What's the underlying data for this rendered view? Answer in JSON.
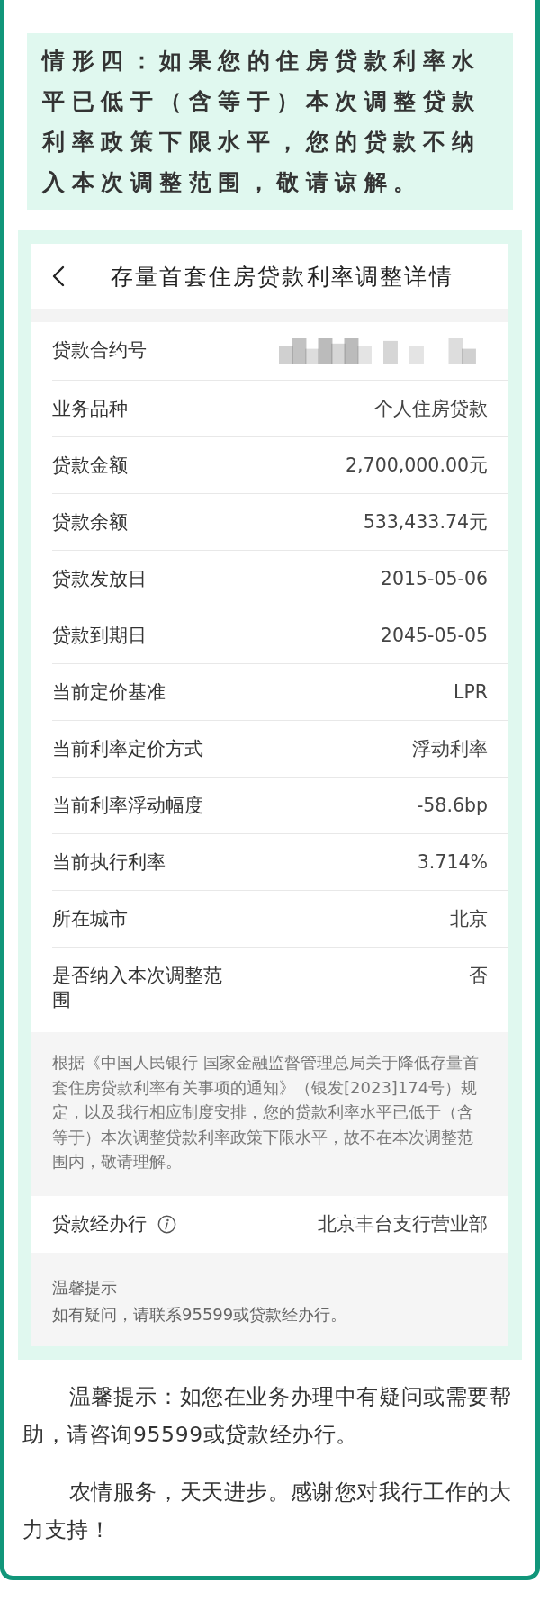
{
  "callout": {
    "text": "情形四：如果您的住房贷款利率水平已低于（含等于）本次调整贷款利率政策下限水平，您的贷款不纳入本次调整范围，敬请谅解。"
  },
  "detail_page": {
    "title": "存量首套住房贷款利率调整详情",
    "rows": [
      {
        "label": "贷款合约号",
        "kind": "blurred"
      },
      {
        "label": "业务品种",
        "kind": "text",
        "value": "个人住房贷款"
      },
      {
        "label": "贷款金额",
        "kind": "text",
        "value": "2,700,000.00元"
      },
      {
        "label": "贷款余额",
        "kind": "text",
        "value": "533,433.74元"
      },
      {
        "label": "贷款发放日",
        "kind": "text",
        "value": "2015-05-06"
      },
      {
        "label": "贷款到期日",
        "kind": "text",
        "value": "2045-05-05"
      },
      {
        "label": "当前定价基准",
        "kind": "text",
        "value": "LPR"
      },
      {
        "label": "当前利率定价方式",
        "kind": "text",
        "value": "浮动利率"
      },
      {
        "label": "当前利率浮动幅度",
        "kind": "text",
        "value": "-58.6bp"
      },
      {
        "label": "当前执行利率",
        "kind": "text",
        "value": "3.714%"
      },
      {
        "label": "所在城市",
        "kind": "text",
        "value": "北京"
      },
      {
        "label": "是否纳入本次调整范围",
        "kind": "text",
        "value": "否"
      }
    ],
    "note": "根据《中国人民银行 国家金融监督管理总局关于降低存量首套住房贷款利率有关事项的通知》（银发[2023]174号）规定，以及我行相应制度安排，您的贷款利率水平已低于（含等于）本次调整贷款利率政策下限水平，故不在本次调整范围内，敬请理解。",
    "branch": {
      "label": "贷款经办行",
      "value": "北京丰台支行营业部"
    },
    "tip": {
      "title": "温馨提示",
      "text": "如有疑问，请联系95599或贷款经办行。"
    }
  },
  "paragraphs": [
    "温馨提示：如您在业务办理中有疑问或需要帮助，请咨询95599或贷款经办行。",
    "农情服务，天天进步。感谢您对我行工作的大力支持！"
  ]
}
